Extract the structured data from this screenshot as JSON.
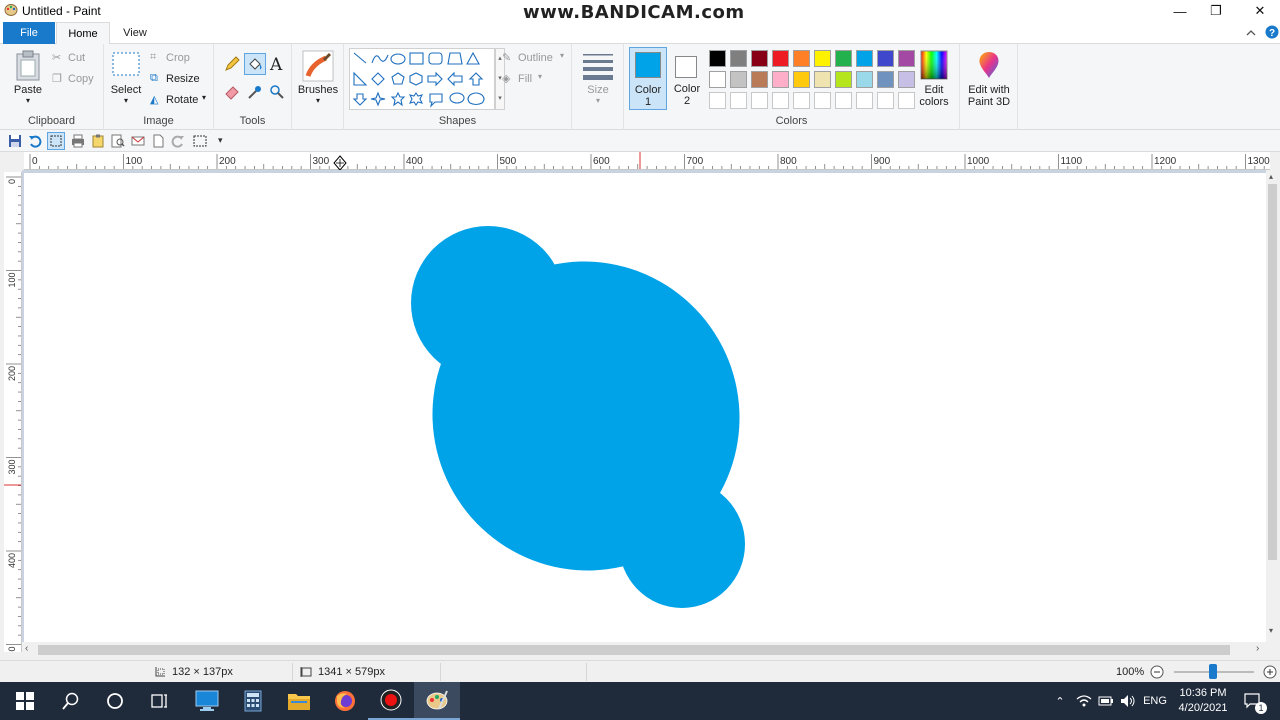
{
  "window": {
    "title": "Untitled - Paint",
    "watermark": "www.BANDICAM.com",
    "minimize_glyph": "—",
    "restore_glyph": "❐",
    "close_glyph": "✕"
  },
  "menubar": {
    "file_tab": "File",
    "home_tab": "Home",
    "view_tab": "View"
  },
  "ribbon": {
    "clipboard": {
      "label": "Clipboard",
      "paste": "Paste",
      "cut": "Cut",
      "copy": "Copy"
    },
    "image": {
      "label": "Image",
      "select": "Select",
      "crop": "Crop",
      "resize": "Resize",
      "rotate": "Rotate"
    },
    "tools": {
      "label": "Tools"
    },
    "brushes": {
      "label": "Brushes"
    },
    "shapes": {
      "label": "Shapes",
      "outline": "Outline",
      "fill": "Fill"
    },
    "size": {
      "label": "Size"
    },
    "color1": {
      "label1": "Color",
      "label2": "1",
      "value": "#00a2e8"
    },
    "color2": {
      "label1": "Color",
      "label2": "2",
      "value": "#ffffff"
    },
    "colors": {
      "label": "Colors",
      "row1": [
        "#000000",
        "#7f7f7f",
        "#880015",
        "#ed1c24",
        "#ff7f27",
        "#fff200",
        "#22b14c",
        "#00a2e8",
        "#3f48cc",
        "#a349a4"
      ],
      "row2": [
        "#ffffff",
        "#c3c3c3",
        "#b97a57",
        "#ffaec9",
        "#ffc90e",
        "#efe4b0",
        "#b5e61d",
        "#99d9ea",
        "#7092be",
        "#c8bfe7"
      ]
    },
    "edit_colors": {
      "line1": "Edit",
      "line2": "colors"
    },
    "edit_paint3d": {
      "line1": "Edit with",
      "line2": "Paint 3D"
    }
  },
  "rulers": {
    "top": [
      "0",
      "100",
      "200",
      "300",
      "400",
      "500",
      "600",
      "700",
      "800",
      "900",
      "1000",
      "1100",
      "1200",
      "1300"
    ],
    "left": [
      "0",
      "100",
      "200",
      "300",
      "400",
      "00"
    ]
  },
  "canvas": {
    "fill_color": "#00a2e8"
  },
  "statusbar": {
    "selection_size": "132 × 137px",
    "image_size": "1341 × 579px",
    "zoom": "100%"
  },
  "taskbar": {
    "lang": "ENG",
    "time": "10:36 PM",
    "date": "4/20/2021",
    "notification_count": "1"
  }
}
